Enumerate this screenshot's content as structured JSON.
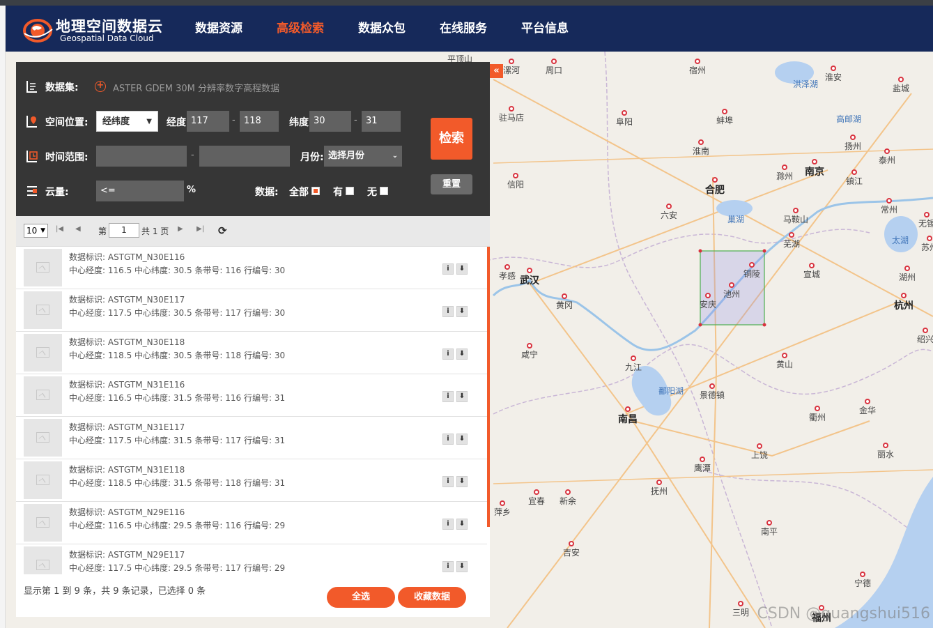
{
  "header": {
    "logo_cn": "地理空间数据云",
    "logo_en": "Geospatial Data Cloud",
    "nav": [
      {
        "label": "数据资源",
        "active": false
      },
      {
        "label": "高级检索",
        "active": true
      },
      {
        "label": "数据众包",
        "active": false
      },
      {
        "label": "在线服务",
        "active": false
      },
      {
        "label": "平台信息",
        "active": false
      }
    ],
    "accent_color": "#f25a2a",
    "bar_color": "#16295a"
  },
  "query": {
    "dataset_label": "数据集:",
    "dataset_name": "ASTER GDEM 30M 分辨率数字高程数据",
    "location_label": "空间位置:",
    "location_mode": "经纬度",
    "lon_label": "经度:",
    "lon_min": "117",
    "lon_max": "118",
    "lat_label": "纬度:",
    "lat_min": "30",
    "lat_max": "31",
    "time_label": "时间范围:",
    "month_label": "月份:",
    "month_value": "选择月份",
    "cloud_label": "云量:",
    "cloud_value": "<=",
    "cloud_unit": "%",
    "data_label": "数据:",
    "data_options": [
      {
        "label": "全部",
        "checked": true
      },
      {
        "label": "有",
        "checked": false
      },
      {
        "label": "无",
        "checked": false
      }
    ],
    "search_button": "检索",
    "reset_button": "重置",
    "dash": "-"
  },
  "pager": {
    "page_size": "10",
    "page_prefix": "第",
    "page_number": "1",
    "page_suffix": "共 1 页"
  },
  "results": [
    {
      "id": "ASTGTM_N30E116",
      "lon": "116.5",
      "lat": "30.5",
      "path": "116",
      "row": "30"
    },
    {
      "id": "ASTGTM_N30E117",
      "lon": "117.5",
      "lat": "30.5",
      "path": "117",
      "row": "30"
    },
    {
      "id": "ASTGTM_N30E118",
      "lon": "118.5",
      "lat": "30.5",
      "path": "118",
      "row": "30"
    },
    {
      "id": "ASTGTM_N31E116",
      "lon": "116.5",
      "lat": "31.5",
      "path": "116",
      "row": "31"
    },
    {
      "id": "ASTGTM_N31E117",
      "lon": "117.5",
      "lat": "31.5",
      "path": "117",
      "row": "31"
    },
    {
      "id": "ASTGTM_N31E118",
      "lon": "118.5",
      "lat": "31.5",
      "path": "118",
      "row": "31"
    },
    {
      "id": "ASTGTM_N29E116",
      "lon": "116.5",
      "lat": "29.5",
      "path": "116",
      "row": "29"
    },
    {
      "id": "ASTGTM_N29E117",
      "lon": "117.5",
      "lat": "29.5",
      "path": "117",
      "row": "29"
    }
  ],
  "result_labels": {
    "id_label": "数据标识:",
    "lon_label": "中心经度:",
    "lat_label": "中心纬度:",
    "path_label": "条带号:",
    "row_label": "行编号:",
    "info_button": "i",
    "download_button": "⬇"
  },
  "footer": {
    "summary": "显示第 1 到 9 条，共 9 条记录，已选择 0 条",
    "select_all": "全选",
    "favorite": "收藏数据"
  },
  "map": {
    "collapse_label": "«",
    "watermark": "CSDN @guangshui516",
    "cities": [
      {
        "name": "平顶山",
        "type": "normal"
      },
      {
        "name": "漯河",
        "type": "normal"
      },
      {
        "name": "周口",
        "type": "normal"
      },
      {
        "name": "宿州",
        "type": "normal"
      },
      {
        "name": "淮安",
        "type": "normal"
      },
      {
        "name": "盐城",
        "type": "normal"
      },
      {
        "name": "洪泽湖",
        "type": "blue"
      },
      {
        "name": "驻马店",
        "type": "normal"
      },
      {
        "name": "阜阳",
        "type": "normal"
      },
      {
        "name": "蚌埠",
        "type": "normal"
      },
      {
        "name": "高邮湖",
        "type": "blue"
      },
      {
        "name": "淮南",
        "type": "normal"
      },
      {
        "name": "扬州",
        "type": "normal"
      },
      {
        "name": "泰州",
        "type": "normal"
      },
      {
        "name": "信阳",
        "type": "normal"
      },
      {
        "name": "合肥",
        "type": "big"
      },
      {
        "name": "滁州",
        "type": "normal"
      },
      {
        "name": "南京",
        "type": "big"
      },
      {
        "name": "镇江",
        "type": "normal"
      },
      {
        "name": "六安",
        "type": "normal"
      },
      {
        "name": "巢湖",
        "type": "blue"
      },
      {
        "name": "马鞍山",
        "type": "normal"
      },
      {
        "name": "常州",
        "type": "normal"
      },
      {
        "name": "无锡",
        "type": "normal"
      },
      {
        "name": "芜湖",
        "type": "normal"
      },
      {
        "name": "太湖",
        "type": "blue"
      },
      {
        "name": "苏州",
        "type": "normal"
      },
      {
        "name": "孝感",
        "type": "normal"
      },
      {
        "name": "武汉",
        "type": "big"
      },
      {
        "name": "铜陵",
        "type": "normal"
      },
      {
        "name": "宣城",
        "type": "normal"
      },
      {
        "name": "湖州",
        "type": "normal"
      },
      {
        "name": "池州",
        "type": "normal"
      },
      {
        "name": "安庆",
        "type": "normal"
      },
      {
        "name": "黄冈",
        "type": "normal"
      },
      {
        "name": "杭州",
        "type": "big"
      },
      {
        "name": "绍兴",
        "type": "normal"
      },
      {
        "name": "咸宁",
        "type": "normal"
      },
      {
        "name": "黄山",
        "type": "normal"
      },
      {
        "name": "九江",
        "type": "normal"
      },
      {
        "name": "鄱阳湖",
        "type": "blue"
      },
      {
        "name": "景德镇",
        "type": "normal"
      },
      {
        "name": "衢州",
        "type": "normal"
      },
      {
        "name": "金华",
        "type": "normal"
      },
      {
        "name": "南昌",
        "type": "big"
      },
      {
        "name": "上饶",
        "type": "normal"
      },
      {
        "name": "丽水",
        "type": "normal"
      },
      {
        "name": "鹰潭",
        "type": "normal"
      },
      {
        "name": "抚州",
        "type": "normal"
      },
      {
        "name": "宜春",
        "type": "normal"
      },
      {
        "name": "新余",
        "type": "normal"
      },
      {
        "name": "萍乡",
        "type": "normal"
      },
      {
        "name": "南平",
        "type": "normal"
      },
      {
        "name": "吉安",
        "type": "normal"
      },
      {
        "name": "宁德",
        "type": "normal"
      },
      {
        "name": "三明",
        "type": "normal"
      },
      {
        "name": "福州",
        "type": "big"
      }
    ]
  }
}
